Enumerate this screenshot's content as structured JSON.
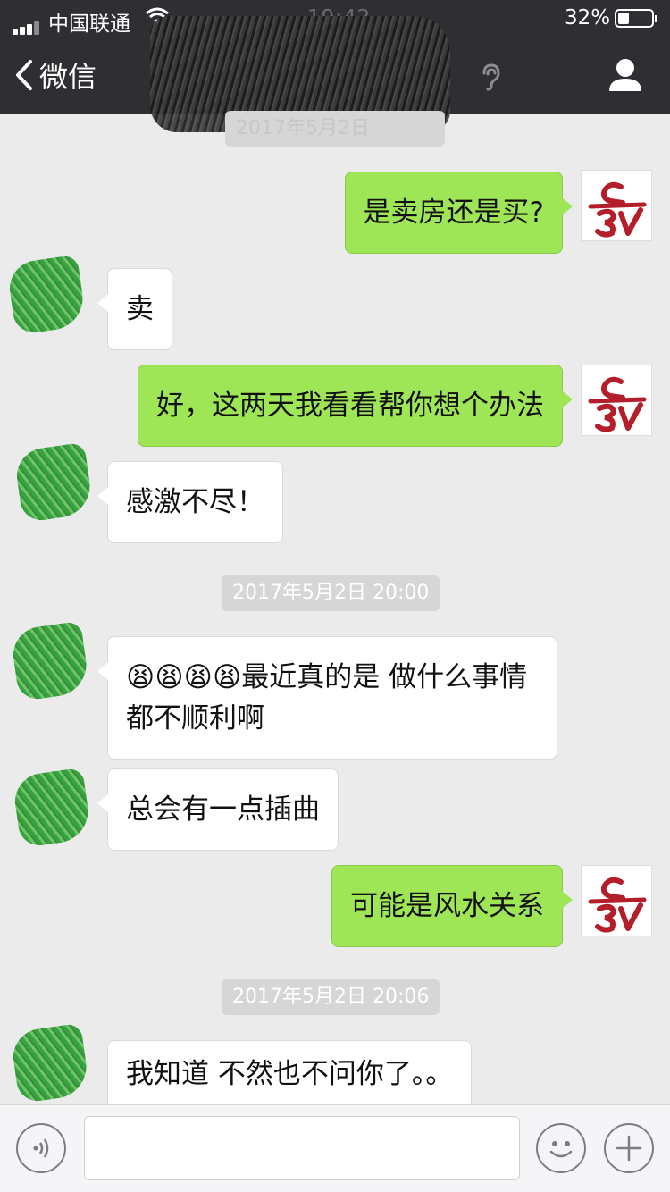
{
  "status_bar": {
    "carrier": "中国联通",
    "time": "19:42",
    "battery": "32%",
    "battery_level": 0.32
  },
  "nav": {
    "back_label": "微信"
  },
  "timestamps": {
    "ts1": "2017年5月2日",
    "ts2": "2017年5月2日 20:00",
    "ts3": "2017年5月2日 20:06"
  },
  "messages": [
    {
      "side": "right",
      "text": "是卖房还是买?"
    },
    {
      "side": "left",
      "text": "卖"
    },
    {
      "side": "right",
      "text": "好，这两天我看看帮你想个办法"
    },
    {
      "side": "left",
      "text": "感激不尽！"
    },
    {
      "side": "left",
      "text": "😫😫😫😫最近真的是 做什么事情都不顺利啊"
    },
    {
      "side": "left",
      "text": "总会有一点插曲"
    },
    {
      "side": "right",
      "text": "可能是风水关系"
    },
    {
      "side": "left",
      "text": "我知道 不然也不问你了。。"
    }
  ],
  "input": {
    "value": "",
    "placeholder": ""
  },
  "colors": {
    "header_bg": "#2e2e33",
    "self_bubble": "#9fe657",
    "other_bubble": "#ffffff",
    "chat_bg": "#ebebeb",
    "avatar_logo": "#b41e2a"
  },
  "icons": {
    "back": "chevron-left-icon",
    "ear": "ear-icon",
    "profile": "person-icon",
    "voice": "voice-icon",
    "emoji": "emoji-icon",
    "add": "plus-icon"
  }
}
